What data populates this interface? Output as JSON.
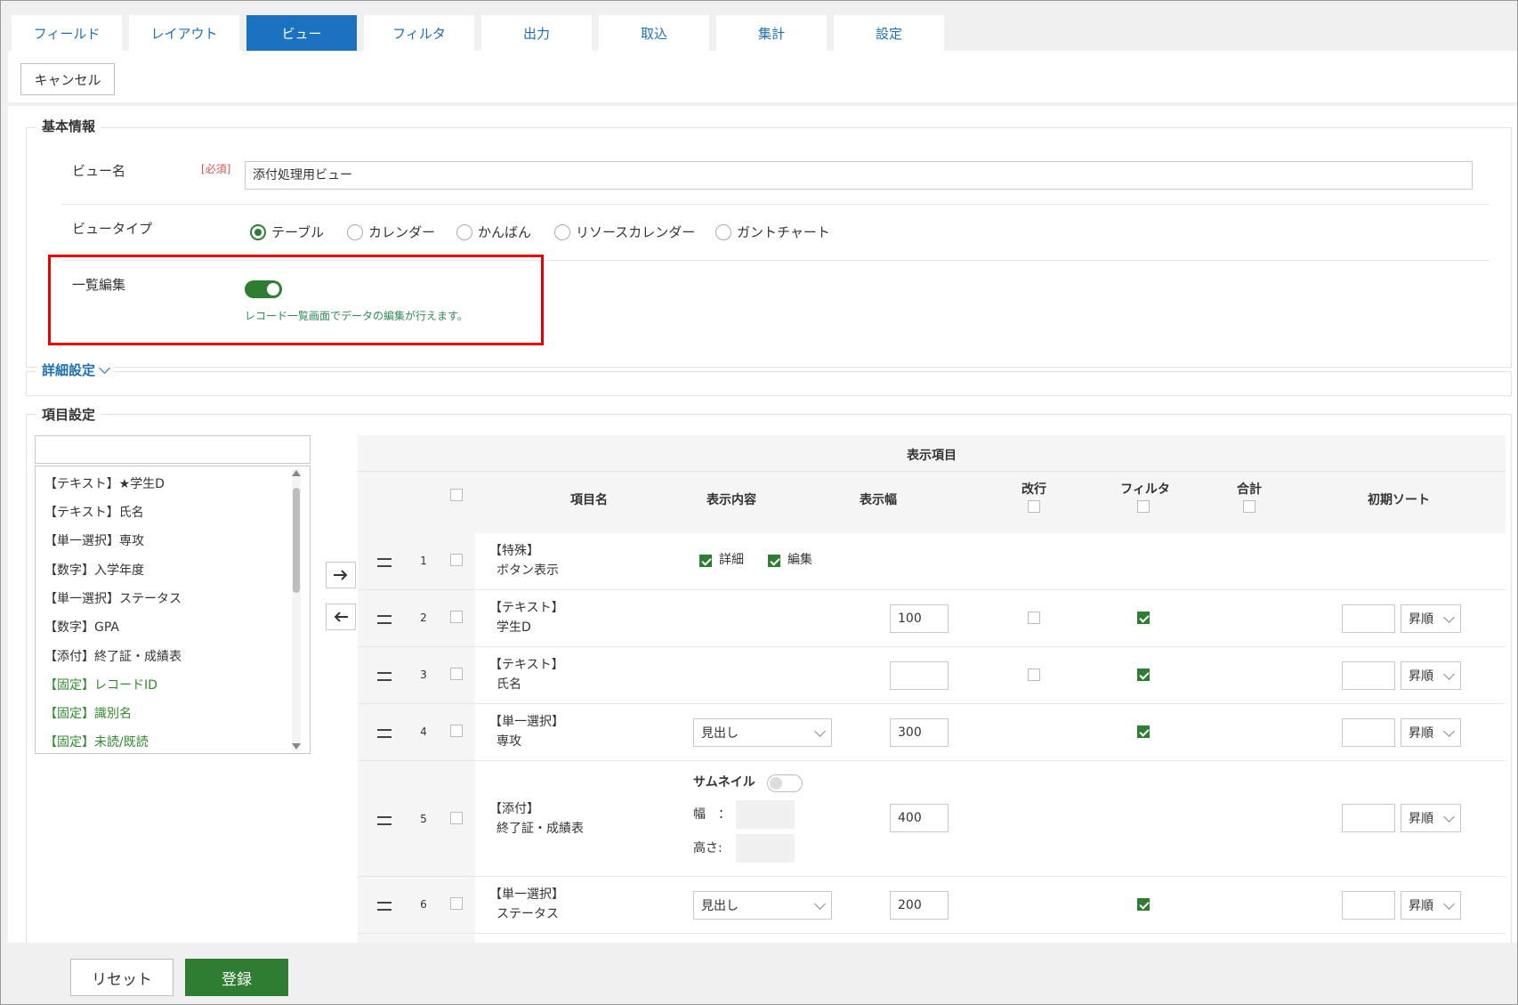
{
  "tabs": [
    {
      "label": "フィールド",
      "active": false
    },
    {
      "label": "レイアウト",
      "active": false
    },
    {
      "label": "ビュー",
      "active": true
    },
    {
      "label": "フィルタ",
      "active": false
    },
    {
      "label": "出力",
      "active": false
    },
    {
      "label": "取込",
      "active": false
    },
    {
      "label": "集計",
      "active": false
    },
    {
      "label": "設定",
      "active": false
    }
  ],
  "toolbar": {
    "cancel_label": "キャンセル"
  },
  "basic": {
    "legend": "基本情報",
    "view_name_label": "ビュー名",
    "required_label": "[必須]",
    "view_name_value": "添付処理用ビュー",
    "view_type_label": "ビュータイプ",
    "view_types": [
      "テーブル",
      "カレンダー",
      "かんばん",
      "リソースカレンダー",
      "ガントチャート"
    ],
    "selected_view_type": "テーブル",
    "list_edit_label": "一覧編集",
    "list_edit_enabled": true,
    "list_edit_help": "レコード一覧画面でデータの編集が行えます。"
  },
  "details": {
    "label": "詳細設定"
  },
  "items": {
    "legend": "項目設定",
    "search_value": "",
    "available": [
      {
        "label": "【テキスト】★学生D",
        "fixed": false
      },
      {
        "label": "【テキスト】氏名",
        "fixed": false
      },
      {
        "label": "【単一選択】専攻",
        "fixed": false
      },
      {
        "label": "【数字】入学年度",
        "fixed": false
      },
      {
        "label": "【単一選択】ステータス",
        "fixed": false
      },
      {
        "label": "【数字】GPA",
        "fixed": false
      },
      {
        "label": "【添付】終了証・成績表",
        "fixed": false
      },
      {
        "label": "【固定】レコードID",
        "fixed": true
      },
      {
        "label": "【固定】識別名",
        "fixed": true
      },
      {
        "label": "【固定】未読/既読",
        "fixed": true
      }
    ]
  },
  "table": {
    "header_group": "表示項目",
    "col_name": "項目名",
    "col_content": "表示内容",
    "col_width": "表示幅",
    "col_wrap": "改行",
    "col_filter": "フィルタ",
    "col_total": "合計",
    "col_sort": "初期ソート",
    "rows": [
      {
        "no": "1",
        "type": "【特殊】",
        "name": "ボタン表示",
        "detail_label": "詳細",
        "edit_label": "編集"
      },
      {
        "no": "2",
        "type": "【テキスト】",
        "name": "学生D",
        "width": "100",
        "sort_dir": "昇順"
      },
      {
        "no": "3",
        "type": "【テキスト】",
        "name": "氏名",
        "width": "",
        "sort_dir": "昇順"
      },
      {
        "no": "4",
        "type": "【単一選択】",
        "name": "専攻",
        "content": "見出し",
        "width": "300",
        "sort_dir": "昇順"
      },
      {
        "no": "5",
        "type": "【添付】",
        "name": "終了証・成績表",
        "thumb_label": "サムネイル",
        "w_label": "幅　：",
        "h_label": "高さ:",
        "width": "400",
        "sort_dir": "昇順"
      },
      {
        "no": "6",
        "type": "【単一選択】",
        "name": "ステータス",
        "content": "見出し",
        "width": "200",
        "sort_dir": "昇順"
      }
    ]
  },
  "footer": {
    "reset_label": "リセット",
    "submit_label": "登録"
  }
}
